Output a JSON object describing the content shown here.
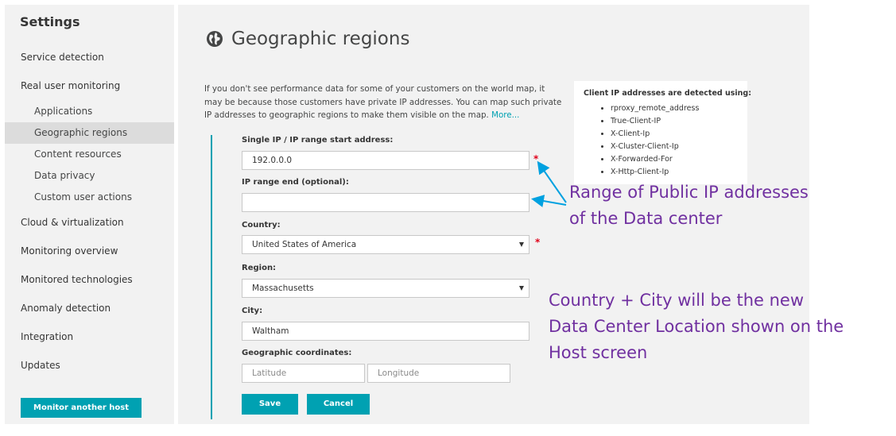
{
  "sidebar": {
    "title": "Settings",
    "items": [
      {
        "label": "Service detection"
      },
      {
        "label": "Real user monitoring"
      },
      {
        "label": "Applications"
      },
      {
        "label": "Geographic regions"
      },
      {
        "label": "Content resources"
      },
      {
        "label": "Data privacy"
      },
      {
        "label": "Custom user actions"
      },
      {
        "label": "Cloud & virtualization"
      },
      {
        "label": "Monitoring overview"
      },
      {
        "label": "Monitored technologies"
      },
      {
        "label": "Anomaly detection"
      },
      {
        "label": "Integration"
      },
      {
        "label": "Updates"
      }
    ],
    "active_item": "Geographic regions",
    "monitor_button": "Monitor another host"
  },
  "main": {
    "title": "Geographic regions",
    "title_icon": "globe-icon",
    "description": "If you don't see performance data for some of your customers on the world map, it may be because those customers have private IP addresses. You can map such private IP addresses to geographic regions to make them visible on the map.",
    "more_link": "More...",
    "infobox": {
      "title": "Client IP addresses are detected using:",
      "items": [
        "rproxy_remote_address",
        "True-Client-IP",
        "X-Client-Ip",
        "X-Cluster-Client-Ip",
        "X-Forwarded-For",
        "X-Http-Client-Ip"
      ]
    },
    "form": {
      "ip_start_label": "Single IP / IP range start address:",
      "ip_start_value": "192.0.0.0",
      "ip_end_label": "IP range end (optional):",
      "ip_end_value": "",
      "country_label": "Country:",
      "country_value": "United States of America",
      "region_label": "Region:",
      "region_value": "Massachusetts",
      "city_label": "City:",
      "city_value": "Waltham",
      "coords_label": "Geographic coordinates:",
      "latitude_placeholder": "Latitude",
      "longitude_placeholder": "Longitude",
      "required_marker": "*",
      "save_label": "Save",
      "cancel_label": "Cancel"
    }
  },
  "annotations": {
    "ip_range_lines": [
      "Range of Public IP addresses",
      "of the Data center"
    ],
    "location_lines": [
      "Country + City will be the new",
      "Data Center Location shown on the",
      "Host screen"
    ],
    "color": "#7030a0"
  },
  "colors": {
    "accent": "#00a1b2",
    "required": "#e0001a",
    "annotation": "#7030a0"
  }
}
